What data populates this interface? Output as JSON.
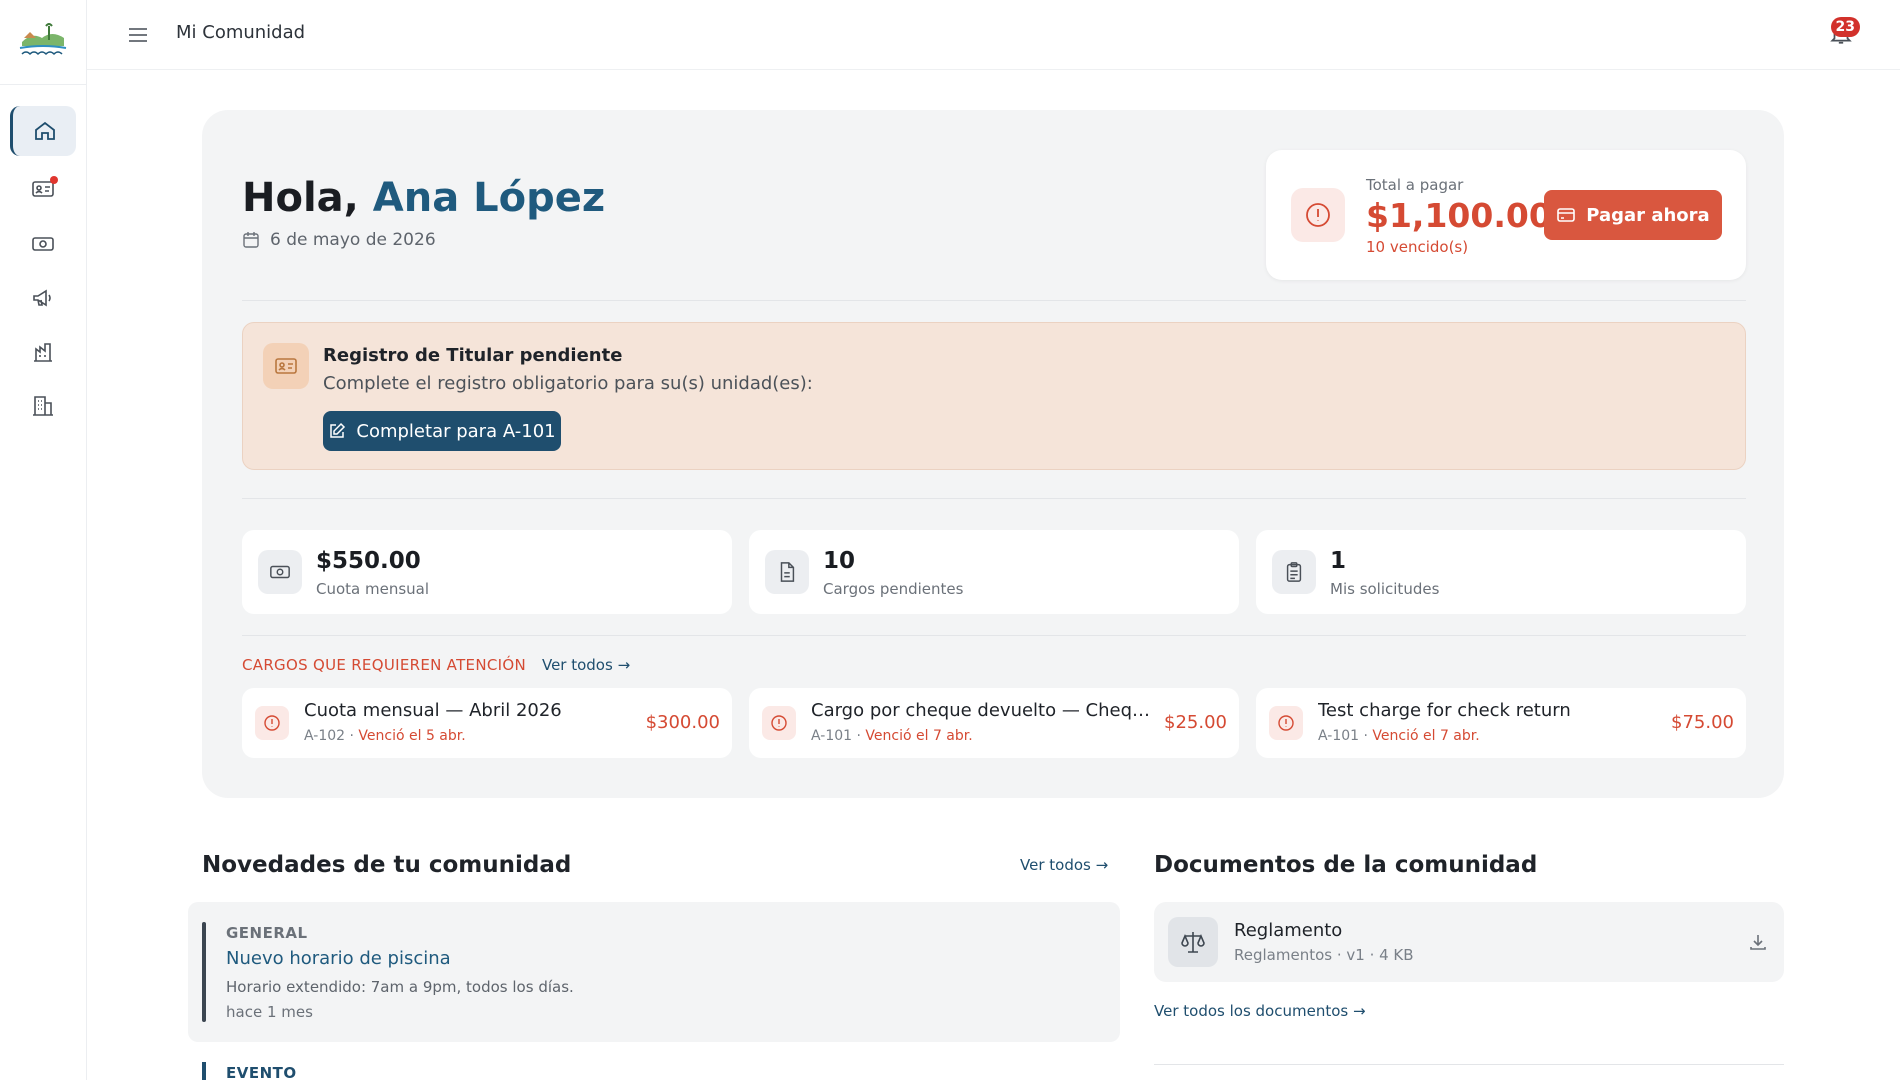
{
  "topbar": {
    "title": "Mi Comunidad",
    "notification_count": "23"
  },
  "sidebar": {
    "items": [
      {
        "name": "home-icon",
        "active": true
      },
      {
        "name": "id-card-icon",
        "dot": true
      },
      {
        "name": "money-icon"
      },
      {
        "name": "megaphone-icon"
      },
      {
        "name": "chart-building-icon"
      },
      {
        "name": "building-icon"
      }
    ]
  },
  "hero": {
    "greeting": "Hola,",
    "user_name": "Ana López",
    "date": "6 de mayo de 2026"
  },
  "payment": {
    "label": "Total a pagar",
    "amount": "$1,100.00",
    "overdue": "10 vencido(s)",
    "button": "Pagar ahora"
  },
  "alert": {
    "title": "Registro de Titular pendiente",
    "text": "Complete el registro obligatorio para su(s) unidad(es):",
    "button": "Completar para A-101"
  },
  "stats": [
    {
      "value": "$550.00",
      "label": "Cuota mensual"
    },
    {
      "value": "10",
      "label": "Cargos pendientes"
    },
    {
      "value": "1",
      "label": "Mis solicitudes"
    }
  ],
  "charges_section": {
    "title": "CARGOS QUE REQUIEREN ATENCIÓN",
    "link": "Ver todos →"
  },
  "charges": [
    {
      "title": "Cuota mensual — Abril 2026",
      "unit": "A-102 · ",
      "due": "Venció el 5 abr.",
      "amount": "$300.00"
    },
    {
      "title": "Cargo por cheque devuelto — Cheque ...",
      "unit": "A-101 · ",
      "due": "Venció el 7 abr.",
      "amount": "$25.00"
    },
    {
      "title": "Test charge for check return",
      "unit": "A-101 · ",
      "due": "Venció el 7 abr.",
      "amount": "$75.00"
    }
  ],
  "news": {
    "title": "Novedades de tu comunidad",
    "link": "Ver todos →",
    "items": [
      {
        "category": "GENERAL",
        "headline": "Nuevo horario de piscina",
        "body": "Horario extendido: 7am a 9pm, todos los días.",
        "time": "hace 1 mes"
      },
      {
        "category": "EVENTO"
      }
    ]
  },
  "documents": {
    "title": "Documentos de la comunidad",
    "items": [
      {
        "name": "Reglamento",
        "meta": "Reglamentos · v1 · 4 KB"
      }
    ],
    "link": "Ver todos los documentos →"
  },
  "colors": {
    "primary": "#1f4e6e",
    "danger": "#d54a33",
    "pay_button": "#d9573f",
    "alert_bg": "#f5e4d9",
    "panel_bg": "#f3f4f5"
  }
}
